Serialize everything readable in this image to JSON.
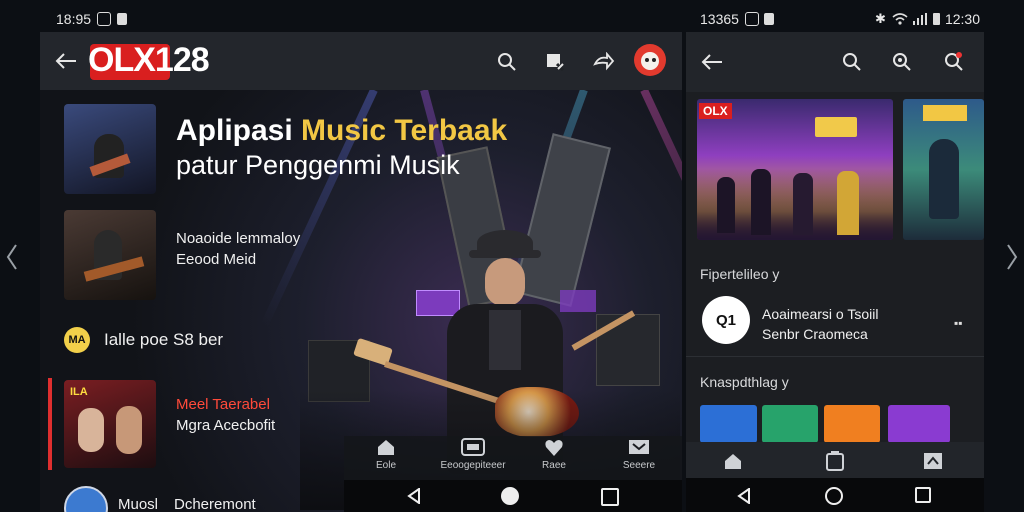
{
  "status_left": {
    "time": "18:95"
  },
  "status_right": {
    "time": "13365",
    "clock": "12:30"
  },
  "left_app": {
    "logo_red": "OLX",
    "logo_white": "128",
    "hero_title_line1_a": "Aplipasi ",
    "hero_title_line1_b": "Music Terbaak",
    "hero_title_line2": "patur Penggenmi Musik",
    "list": [
      {
        "line1": "Noaoide lemmaloy",
        "line2": "Eeood Meid"
      },
      {
        "badge": "MA",
        "line1": "Ialle poe S8 ber"
      },
      {
        "line1": "Meel Taerabel",
        "line2": "Mgra Acecbofit"
      },
      {
        "line1": "Muosl",
        "line2": "Dcheremont"
      }
    ],
    "thumb3_badge": "ILA",
    "nav": [
      {
        "label": "Eole"
      },
      {
        "label": "Eeoogepiteeer"
      },
      {
        "label": "Raee"
      },
      {
        "label": "Seeere"
      }
    ]
  },
  "right_app": {
    "banner_badge": "OLX",
    "section1": "Fipertelileo y",
    "row_icon_text": "Q1",
    "row_line1": "Aoaimearsi o Tsoiil",
    "row_line2": "Senbr Craomeca",
    "section2": "Knaspdthlag y",
    "colors": {
      "card1": "#2c6fd6",
      "card2": "#27a36b",
      "card3": "#f07f20",
      "card4": "#8a3bd1"
    }
  }
}
